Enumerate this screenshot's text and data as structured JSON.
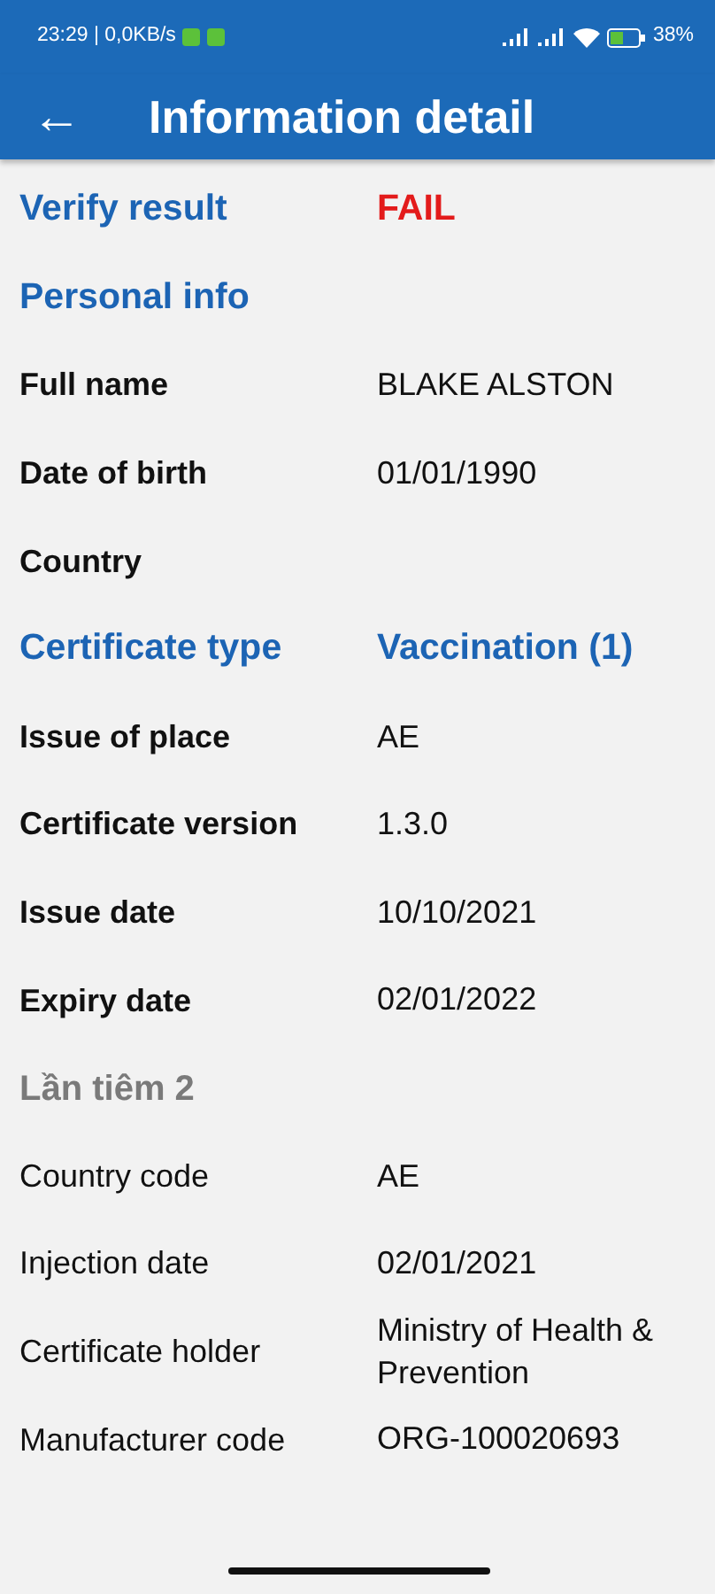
{
  "status_bar": {
    "time_speed": "23:29 | 0,0KB/s",
    "battery": "38%"
  },
  "app_bar": {
    "back": "←",
    "title": "Information detail"
  },
  "rows": [
    {
      "kind": "result",
      "label": "Verify result",
      "value": "FAIL"
    },
    {
      "kind": "heading",
      "label": "Personal info"
    },
    {
      "kind": "field_bold",
      "label": "Full name",
      "value": "BLAKE ALSTON"
    },
    {
      "kind": "field_bold",
      "label": "Date of birth",
      "value": "01/01/1990"
    },
    {
      "kind": "field_bold",
      "label": "Country"
    },
    {
      "kind": "heading_pair",
      "label": "Certificate type",
      "value": "Vaccination (1)"
    },
    {
      "kind": "field_bold",
      "label": "Issue of place",
      "value": "AE"
    },
    {
      "kind": "field_bold",
      "label": "Certificate version",
      "value": "1.3.0"
    },
    {
      "kind": "field_bold",
      "label": "Issue date",
      "value": "10/10/2021"
    },
    {
      "kind": "field_bold",
      "label": "Expiry date",
      "value": "02/01/2022"
    },
    {
      "kind": "subheading",
      "label": "Lần tiêm 2"
    },
    {
      "kind": "field",
      "label": "Country code",
      "value": "AE"
    },
    {
      "kind": "field",
      "label": "Injection date",
      "value": "02/01/2021"
    },
    {
      "kind": "field",
      "label": "Certificate holder",
      "value": "Ministry of Health & Prevention"
    },
    {
      "kind": "field",
      "label": "Manufacturer code",
      "value": "ORG-100020693"
    }
  ]
}
